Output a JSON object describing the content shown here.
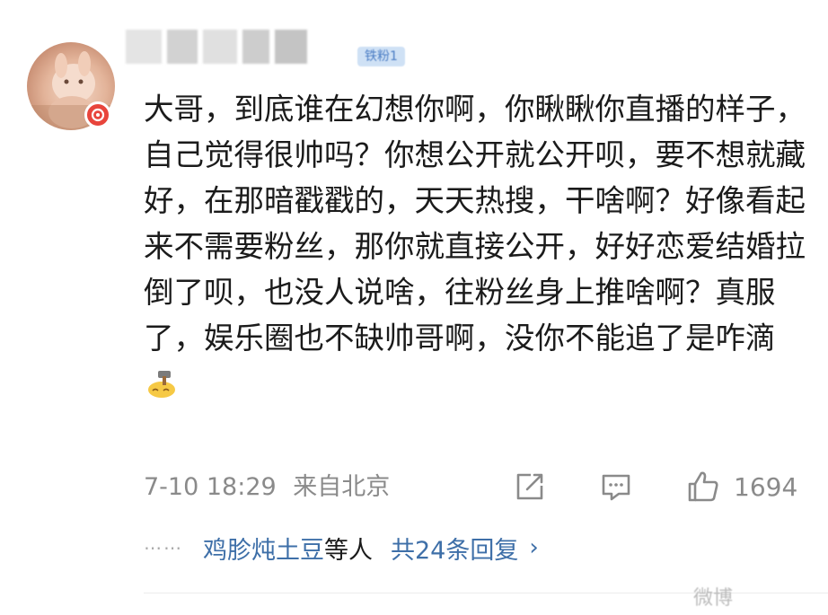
{
  "comment": {
    "fan_tag": "铁粉1",
    "text": "大哥，到底谁在幻想你啊，你瞅瞅你直播的样子，自己觉得很帅吗？你想公开就公开呗，要不想就藏好，在那暗戳戳的，天天热搜，干啥啊？好像看起来不需要粉丝，那你就直接公开，好好恋爱结婚拉倒了呗，也没人说啥，往粉丝身上推啥啊？真服了，娱乐圈也不缺帅哥啊，没你不能追了是咋滴",
    "emoji_icon": "hammer-face-emoji-icon",
    "timestamp": "7-10 18:29",
    "location": "来自北京",
    "like_count": "1694"
  },
  "replies": {
    "dots": "⋯⋯",
    "names": "鸡胗炖土豆",
    "etc": "等人",
    "count_label": "共24条回复",
    "arrow": "›"
  },
  "watermark": "微博",
  "colors": {
    "link": "#3e6fa8",
    "meta": "#8a8a8a",
    "badge": "#e8453c"
  },
  "icons": [
    "share-icon",
    "comment-icon",
    "like-icon",
    "vip-badge-icon"
  ]
}
